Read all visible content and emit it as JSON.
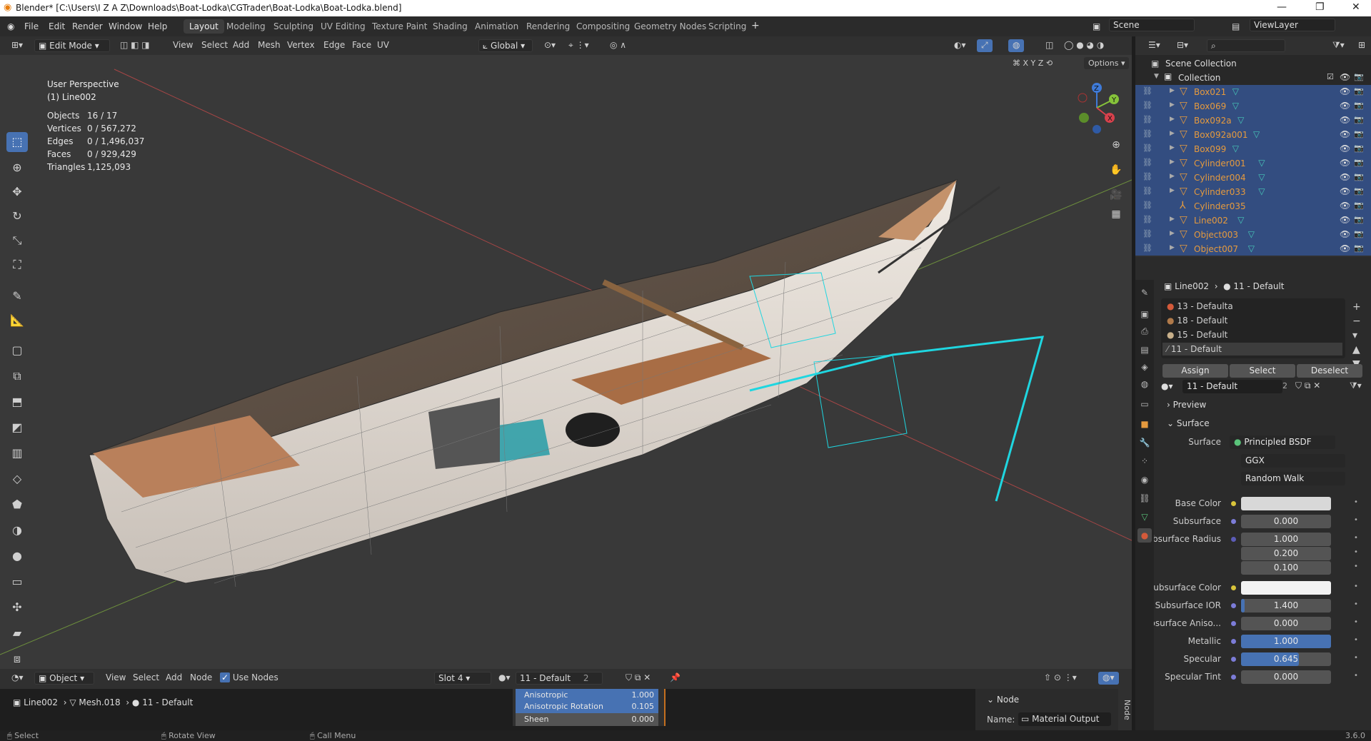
{
  "title_bar": {
    "text": "Blender* [C:\\Users\\I Z A Z\\Downloads\\Boat-Lodka\\CGTrader\\Boat-Lodka\\Boat-Lodka.blend]"
  },
  "menu": [
    "File",
    "Edit",
    "Render",
    "Window",
    "Help"
  ],
  "workspaces": [
    "Layout",
    "Modeling",
    "Sculpting",
    "UV Editing",
    "Texture Paint",
    "Shading",
    "Animation",
    "Rendering",
    "Compositing",
    "Geometry Nodes",
    "Scripting"
  ],
  "active_workspace": "Layout",
  "scene": {
    "scene_name": "Scene",
    "view_layer": "ViewLayer"
  },
  "viewport_header": {
    "mode": "Edit Mode",
    "menus": [
      "View",
      "Select",
      "Add",
      "Mesh",
      "Vertex",
      "Edge",
      "Face",
      "UV"
    ],
    "orientation": "Global",
    "axes": [
      "X",
      "Y",
      "Z"
    ],
    "options": "Options"
  },
  "viewport": {
    "perspective": "User Perspective",
    "object_line": "(1) Line002",
    "stats": [
      {
        "key": "Objects",
        "value": "16 / 17"
      },
      {
        "key": "Vertices",
        "value": "0 / 567,272"
      },
      {
        "key": "Edges",
        "value": "0 / 1,496,037"
      },
      {
        "key": "Faces",
        "value": "0 / 929,429"
      },
      {
        "key": "Triangles",
        "value": "1,125,093"
      }
    ]
  },
  "outliner": {
    "scene_collection": "Scene Collection",
    "collection": "Collection",
    "items": [
      {
        "name": "Box021",
        "selected": true
      },
      {
        "name": "Box069",
        "selected": true
      },
      {
        "name": "Box092a",
        "selected": true
      },
      {
        "name": "Box092a001",
        "selected": true
      },
      {
        "name": "Box099",
        "selected": true
      },
      {
        "name": "Cylinder001",
        "selected": true
      },
      {
        "name": "Cylinder004",
        "selected": true
      },
      {
        "name": "Cylinder033",
        "selected": true
      },
      {
        "name": "Cylinder035",
        "selected": true
      },
      {
        "name": "Line002",
        "selected": true
      },
      {
        "name": "Object003",
        "selected": true
      },
      {
        "name": "Object007",
        "selected": true
      }
    ]
  },
  "properties": {
    "breadcrumb_object": "Line002",
    "breadcrumb_material": "11 - Default",
    "material_slots": [
      "13 - Defaulta",
      "18 - Default",
      "15 - Default",
      "11 - Default"
    ],
    "active_slot_index": 3,
    "buttons": {
      "assign": "Assign",
      "select": "Select",
      "deselect": "Deselect"
    },
    "material_name": "11 - Default",
    "material_users": "2",
    "panels": {
      "preview": "Preview",
      "surface": "Surface"
    },
    "surface_label": "Surface",
    "surface_value": "Principled BSDF",
    "distribution": "GGX",
    "subsurface_method": "Random Walk",
    "fields": [
      {
        "label": "Base Color",
        "value": "",
        "type": "color",
        "color": "#d8d8d8"
      },
      {
        "label": "Subsurface",
        "value": "0.000",
        "type": "num"
      },
      {
        "label": "Subsurface Radius",
        "value": "1.000",
        "type": "num"
      },
      {
        "label": "",
        "value": "0.200",
        "type": "num"
      },
      {
        "label": "",
        "value": "0.100",
        "type": "num"
      },
      {
        "label": "Subsurface Color",
        "value": "",
        "type": "color",
        "color": "#f2f2f2"
      },
      {
        "label": "Subsurface IOR",
        "value": "1.400",
        "type": "num",
        "fill": 0.04
      },
      {
        "label": "Subsurface Aniso...",
        "value": "0.000",
        "type": "num"
      },
      {
        "label": "Metallic",
        "value": "1.000",
        "type": "num",
        "fill": 1.0
      },
      {
        "label": "Specular",
        "value": "0.645",
        "type": "num",
        "fill": 0.645
      },
      {
        "label": "Specular Tint",
        "value": "0.000",
        "type": "num"
      }
    ]
  },
  "node_editor": {
    "mode": "Object",
    "menus": [
      "View",
      "Select",
      "Add",
      "Node"
    ],
    "use_nodes": "Use Nodes",
    "slot": "Slot 4",
    "material": "11 - Default",
    "users": "2",
    "breadcrumb": [
      "Line002",
      "Mesh.018",
      "11 - Default"
    ],
    "sockets": [
      {
        "label": "Anisotropic",
        "value": "1.000"
      },
      {
        "label": "Anisotropic Rotation",
        "value": "0.105"
      },
      {
        "label": "Sheen",
        "value": "0.000"
      }
    ],
    "side_panel": {
      "tab": "Node",
      "section": "Node",
      "name_label": "Name:",
      "name_value": "Material Output"
    }
  },
  "status_bar": {
    "left": "Select",
    "mid": "Rotate View",
    "right": "Call Menu",
    "version": "3.6.0"
  },
  "colors": {
    "accent": "#4772b3",
    "orange": "#e59a3e",
    "wire": "#1fd6e0",
    "sel_row": "#334d80"
  }
}
